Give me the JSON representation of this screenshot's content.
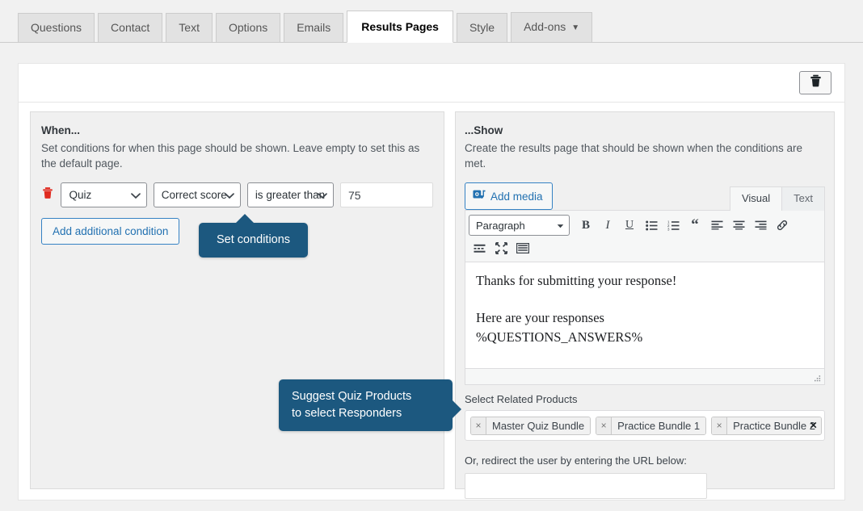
{
  "tabs": [
    {
      "label": "Questions",
      "active": false,
      "caret": false
    },
    {
      "label": "Contact",
      "active": false,
      "caret": false
    },
    {
      "label": "Text",
      "active": false,
      "caret": false
    },
    {
      "label": "Options",
      "active": false,
      "caret": false
    },
    {
      "label": "Emails",
      "active": false,
      "caret": false
    },
    {
      "label": "Results Pages",
      "active": true,
      "caret": false
    },
    {
      "label": "Style",
      "active": false,
      "caret": false
    },
    {
      "label": "Add-ons",
      "active": false,
      "caret": true,
      "caret_glyph": "▼"
    }
  ],
  "header": {
    "delete_icon": "trash-icon"
  },
  "when_panel": {
    "title": "When...",
    "description": "Set conditions for when this page should be shown. Leave empty to set this as the default page.",
    "condition": {
      "delete_icon": "trash-icon",
      "source": "Quiz",
      "field": "Correct score",
      "operator": "is greater than",
      "value": "75",
      "value_placeholder": ""
    },
    "add_condition_label": "Add additional condition"
  },
  "show_panel": {
    "title": "...Show",
    "description": "Create the results page that should be shown when the conditions are met.",
    "add_media_label": "Add media",
    "add_media_icon": "media-icon",
    "editor_tabs": [
      {
        "label": "Visual",
        "active": true
      },
      {
        "label": "Text",
        "active": false
      }
    ],
    "toolbar": {
      "format_select": "Paragraph",
      "row1": [
        {
          "name": "bold-icon",
          "glyph": "B"
        },
        {
          "name": "italic-icon",
          "glyph": "I"
        },
        {
          "name": "underline-icon",
          "glyph": "U"
        },
        {
          "name": "bulleted-list-icon",
          "glyph": ""
        },
        {
          "name": "numbered-list-icon",
          "glyph": ""
        },
        {
          "name": "blockquote-icon",
          "glyph": "“"
        },
        {
          "name": "align-left-icon",
          "glyph": ""
        },
        {
          "name": "align-center-icon",
          "glyph": ""
        },
        {
          "name": "align-right-icon",
          "glyph": ""
        },
        {
          "name": "insert-link-icon",
          "glyph": ""
        }
      ],
      "row2": [
        {
          "name": "read-more-icon",
          "glyph": ""
        },
        {
          "name": "fullscreen-icon",
          "glyph": ""
        },
        {
          "name": "toolbar-toggle-icon",
          "glyph": ""
        }
      ]
    },
    "content": {
      "paragraph1": "Thanks for submitting your response!",
      "paragraph2_line1": "Here are your responses",
      "paragraph2_line2": "%QUESTIONS_ANSWERS%"
    },
    "products_label": "Select Related Products",
    "products": [
      "Master Quiz Bundle",
      "Practice Bundle 1",
      "Practice Bundle 2"
    ],
    "token_remove_glyph": "×",
    "clear_all_glyph": "×",
    "url_label": "Or, redirect the user by entering the URL below:",
    "url_value": "",
    "url_placeholder": ""
  },
  "callouts": {
    "set_conditions": "Set conditions",
    "suggest_products_line1": "Suggest Quiz Products",
    "suggest_products_line2": "to select Responders"
  },
  "colors": {
    "page_background": "#f1f1f1",
    "card_background": "#ffffff",
    "panel_background": "#f0f0f0",
    "accent_blue": "#2271b1",
    "callout_blue": "#1c587f",
    "delete_red": "#e02b20"
  }
}
